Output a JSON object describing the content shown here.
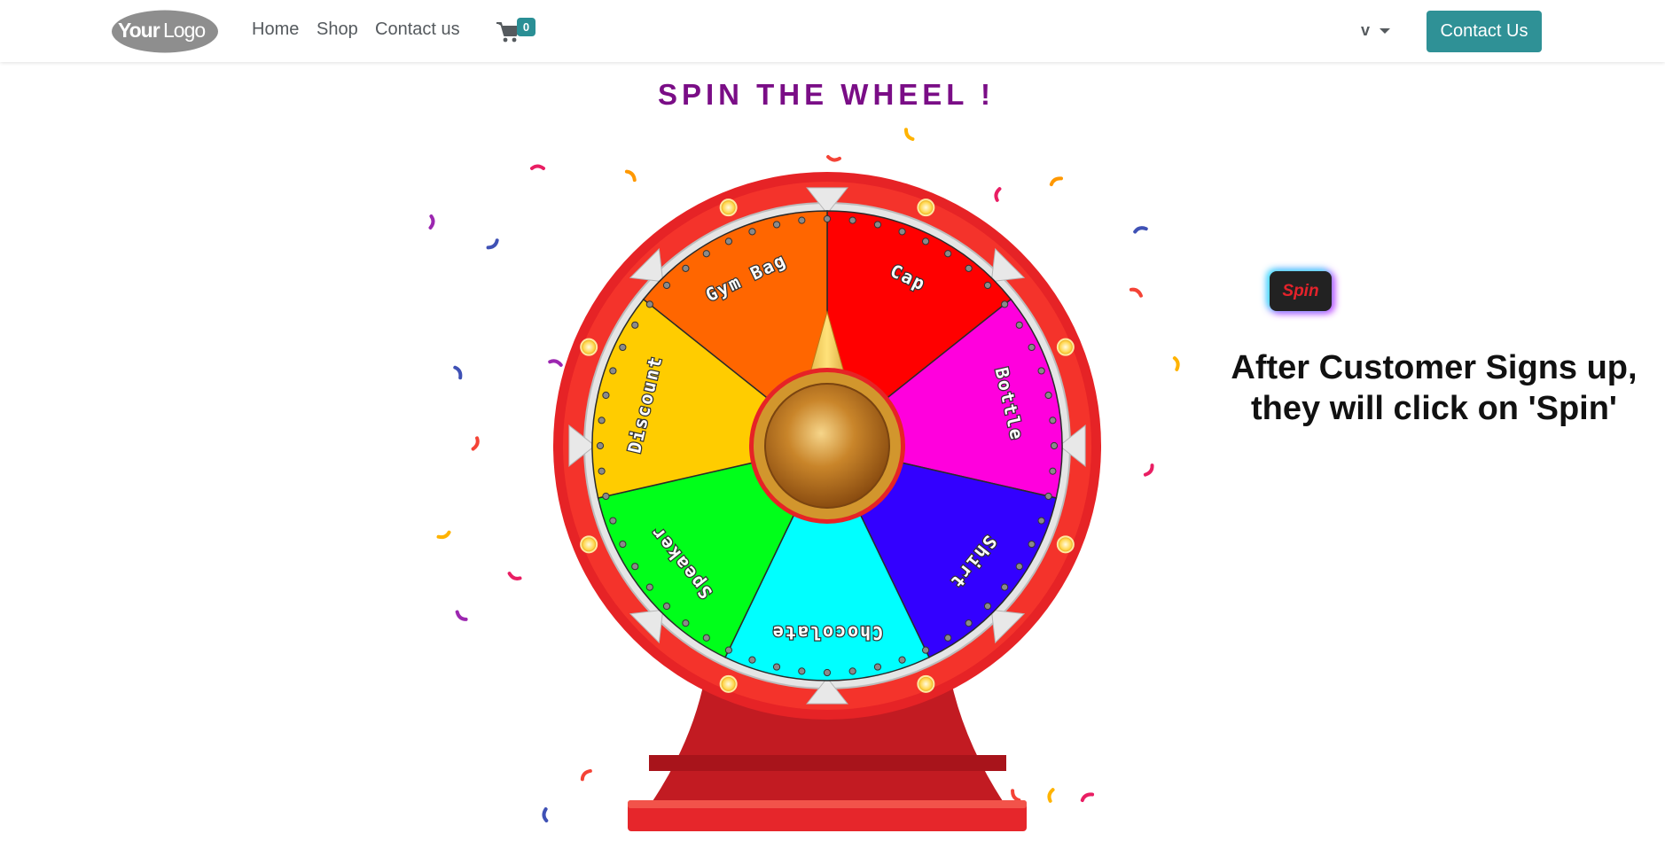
{
  "header": {
    "logo_text": "YourLogo",
    "nav": [
      {
        "label": "Home"
      },
      {
        "label": "Shop"
      },
      {
        "label": "Contact us"
      }
    ],
    "cart_icon": "shopping-cart-icon",
    "cart_count": "0",
    "language_label": "v",
    "contact_button": "Contact Us",
    "accent_color": "#2f9196"
  },
  "main": {
    "title": "SPIN THE WHEEL !",
    "title_color": "#7a0d86",
    "spin_button": "Spin",
    "caption_line1": "After Customer Signs up,",
    "caption_line2": "they will click on 'Spin'"
  },
  "wheel": {
    "segments": [
      {
        "label": "Cap",
        "color": "#ff0000"
      },
      {
        "label": "Bottle",
        "color": "#ff00dd"
      },
      {
        "label": "Shirt",
        "color": "#3300ff"
      },
      {
        "label": "Chocolate",
        "color": "#00ffff"
      },
      {
        "label": "Speaker",
        "color": "#00ff1a"
      },
      {
        "label": "Discount",
        "color": "#ffcc00"
      },
      {
        "label": "Gym Bag",
        "color": "#ff6600"
      }
    ],
    "rim_color": "#e62326",
    "stand_color": "#c21b22"
  }
}
